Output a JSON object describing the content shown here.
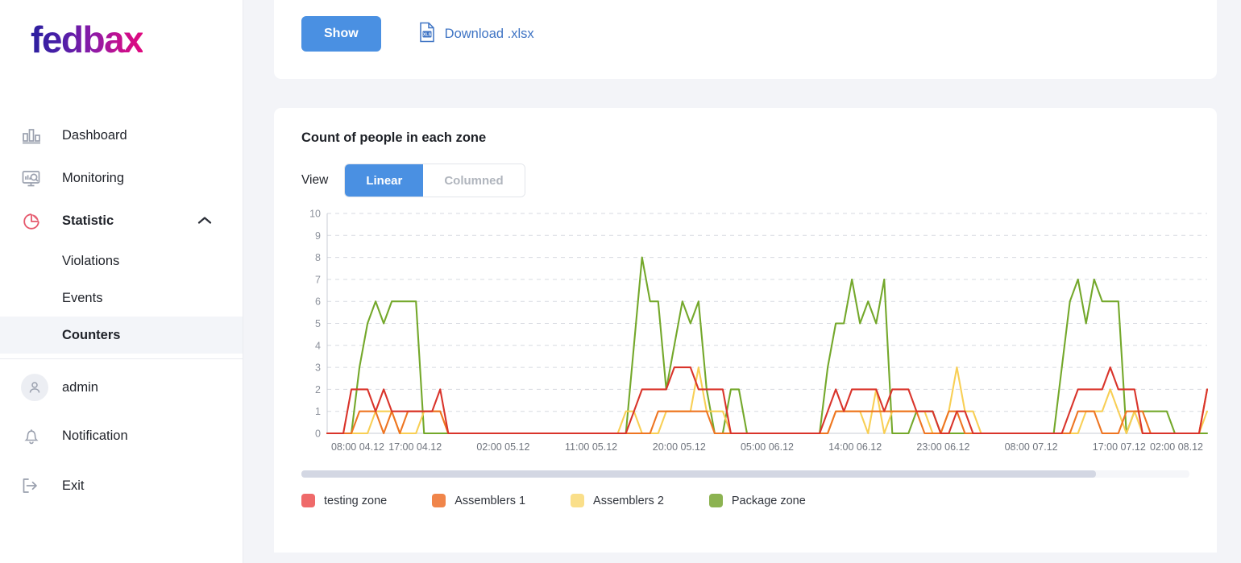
{
  "brand": {
    "name": "fedbax"
  },
  "sidebar": {
    "items": [
      {
        "label": "Dashboard",
        "icon": "bar-chart-icon"
      },
      {
        "label": "Monitoring",
        "icon": "monitor-search-icon"
      },
      {
        "label": "Statistic",
        "icon": "pie-chart-icon",
        "expanded": true,
        "chevron": "chevron-up-icon"
      }
    ],
    "sub_items": [
      {
        "label": "Violations",
        "active": false
      },
      {
        "label": "Events",
        "active": false
      },
      {
        "label": "Counters",
        "active": true
      }
    ],
    "bottom_items": [
      {
        "label": "admin",
        "icon": "user-avatar-icon"
      },
      {
        "label": "Notification",
        "icon": "bell-icon"
      },
      {
        "label": "Exit",
        "icon": "logout-icon"
      }
    ]
  },
  "toolbar": {
    "show_label": "Show",
    "download_label": "Download .xlsx",
    "download_icon": "xls-file-icon",
    "show_button_color": "#4a90e2",
    "download_link_color": "#3f74c4"
  },
  "chart_panel": {
    "title": "Count of people in each zone",
    "view_label": "View",
    "view_options": [
      {
        "label": "Linear",
        "selected": true
      },
      {
        "label": "Columned",
        "selected": false
      }
    ],
    "scrollbar_position_percent": 0
  },
  "chart_data": {
    "type": "line",
    "title": "Count of people in each zone",
    "xlabel": "",
    "ylabel": "",
    "ylim": [
      0,
      10
    ],
    "yticks": [
      0,
      1,
      2,
      3,
      4,
      5,
      6,
      7,
      8,
      9,
      10
    ],
    "grid": true,
    "legend_position": "bottom-left",
    "tick_labels": [
      "08:00 04.12",
      "17:00 04.12",
      "02:00 05.12",
      "11:00 05.12",
      "20:00 05.12",
      "05:00 06.12",
      "14:00 06.12",
      "23:00 06.12",
      "08:00 07.12",
      "17:00 07.12",
      "02:00 08.12"
    ],
    "colors": {
      "testing zone": "#d9342b",
      "Assemblers 1": "#ee7522",
      "Assemblers 2": "#f8cf55",
      "Package zone": "#74a82b"
    },
    "legend_swatch_colors": {
      "testing zone": "#ef6a6a",
      "Assemblers 1": "#f0854a",
      "Assemblers 2": "#fadf8a",
      "Package zone": "#8cb351"
    },
    "x": [
      0,
      1,
      2,
      3,
      4,
      5,
      6,
      7,
      8,
      9,
      10,
      11,
      12,
      13,
      14,
      15,
      16,
      17,
      18,
      19,
      20,
      21,
      22,
      23,
      24,
      25,
      26,
      27,
      28,
      29,
      30,
      31,
      32,
      33,
      34,
      35,
      36,
      37,
      38,
      39,
      40,
      41,
      42,
      43,
      44,
      45,
      46,
      47,
      48,
      49,
      50,
      51,
      52,
      53,
      54,
      55,
      56,
      57,
      58,
      59,
      60,
      61,
      62,
      63,
      64,
      65,
      66,
      67,
      68,
      69,
      70,
      71,
      72,
      73,
      74,
      75,
      76,
      77,
      78,
      79,
      80,
      81,
      82,
      83,
      84,
      85,
      86,
      87,
      88,
      89,
      90,
      91,
      92,
      93,
      94,
      95,
      96,
      97,
      98,
      99,
      100,
      101,
      102,
      103,
      104,
      105,
      106,
      107,
      108,
      109
    ],
    "series": [
      {
        "name": "testing zone",
        "color": "#d9342b",
        "values": [
          0,
          0,
          0,
          2,
          2,
          2,
          1,
          2,
          1,
          1,
          1,
          1,
          1,
          1,
          2,
          0,
          0,
          0,
          0,
          0,
          0,
          0,
          0,
          0,
          0,
          0,
          0,
          0,
          0,
          0,
          0,
          0,
          0,
          0,
          0,
          0,
          0,
          0,
          1,
          2,
          2,
          2,
          2,
          3,
          3,
          3,
          2,
          2,
          2,
          2,
          0,
          0,
          0,
          0,
          0,
          0,
          0,
          0,
          0,
          0,
          0,
          0,
          1,
          2,
          1,
          2,
          2,
          2,
          2,
          1,
          2,
          2,
          2,
          1,
          1,
          1,
          0,
          0,
          1,
          1,
          0,
          0,
          0,
          0,
          0,
          0,
          0,
          0,
          0,
          0,
          0,
          0,
          1,
          2,
          2,
          2,
          2,
          3,
          2,
          2,
          2,
          0,
          0,
          0,
          0,
          0,
          0,
          0,
          0,
          2
        ]
      },
      {
        "name": "Assemblers 1",
        "color": "#ee7522",
        "values": [
          0,
          0,
          0,
          0,
          1,
          1,
          1,
          0,
          1,
          0,
          1,
          1,
          1,
          1,
          1,
          0,
          0,
          0,
          0,
          0,
          0,
          0,
          0,
          0,
          0,
          0,
          0,
          0,
          0,
          0,
          0,
          0,
          0,
          0,
          0,
          0,
          0,
          0,
          0,
          0,
          0,
          1,
          1,
          1,
          1,
          1,
          1,
          1,
          0,
          0,
          0,
          0,
          0,
          0,
          0,
          0,
          0,
          0,
          0,
          0,
          0,
          0,
          0,
          1,
          1,
          1,
          1,
          1,
          1,
          1,
          1,
          1,
          1,
          1,
          0,
          0,
          0,
          1,
          1,
          0,
          0,
          0,
          0,
          0,
          0,
          0,
          0,
          0,
          0,
          0,
          0,
          0,
          0,
          1,
          1,
          1,
          0,
          0,
          0,
          1,
          1,
          1,
          0,
          0,
          0,
          0,
          0,
          0,
          0,
          2
        ]
      },
      {
        "name": "Assemblers 2",
        "color": "#f8cf55",
        "values": [
          0,
          0,
          0,
          0,
          0,
          0,
          1,
          1,
          1,
          0,
          0,
          0,
          1,
          1,
          1,
          0,
          0,
          0,
          0,
          0,
          0,
          0,
          0,
          0,
          0,
          0,
          0,
          0,
          0,
          0,
          0,
          0,
          0,
          0,
          0,
          0,
          0,
          1,
          1,
          0,
          0,
          0,
          1,
          1,
          1,
          1,
          3,
          1,
          1,
          1,
          0,
          0,
          0,
          0,
          0,
          0,
          0,
          0,
          0,
          0,
          0,
          0,
          0,
          1,
          1,
          1,
          1,
          0,
          2,
          0,
          1,
          1,
          1,
          1,
          1,
          0,
          0,
          1,
          3,
          1,
          1,
          0,
          0,
          0,
          0,
          0,
          0,
          0,
          0,
          0,
          0,
          0,
          0,
          0,
          1,
          1,
          1,
          2,
          1,
          0,
          1,
          0,
          0,
          0,
          0,
          0,
          0,
          0,
          0,
          1
        ]
      },
      {
        "name": "Package zone",
        "color": "#74a82b",
        "values": [
          0,
          0,
          0,
          0,
          3,
          5,
          6,
          5,
          6,
          6,
          6,
          6,
          0,
          0,
          0,
          0,
          0,
          0,
          0,
          0,
          0,
          0,
          0,
          0,
          0,
          0,
          0,
          0,
          0,
          0,
          0,
          0,
          0,
          0,
          0,
          0,
          0,
          0,
          4,
          8,
          6,
          6,
          2,
          4,
          6,
          5,
          6,
          2,
          0,
          0,
          2,
          2,
          0,
          0,
          0,
          0,
          0,
          0,
          0,
          0,
          0,
          0,
          3,
          5,
          5,
          7,
          5,
          6,
          5,
          7,
          0,
          0,
          0,
          1,
          1,
          1,
          0,
          0,
          0,
          0,
          0,
          0,
          0,
          0,
          0,
          0,
          0,
          0,
          0,
          0,
          0,
          3,
          6,
          7,
          5,
          7,
          6,
          6,
          6,
          0,
          1,
          1,
          1,
          1,
          1,
          0,
          0,
          0,
          0,
          0
        ]
      }
    ]
  }
}
